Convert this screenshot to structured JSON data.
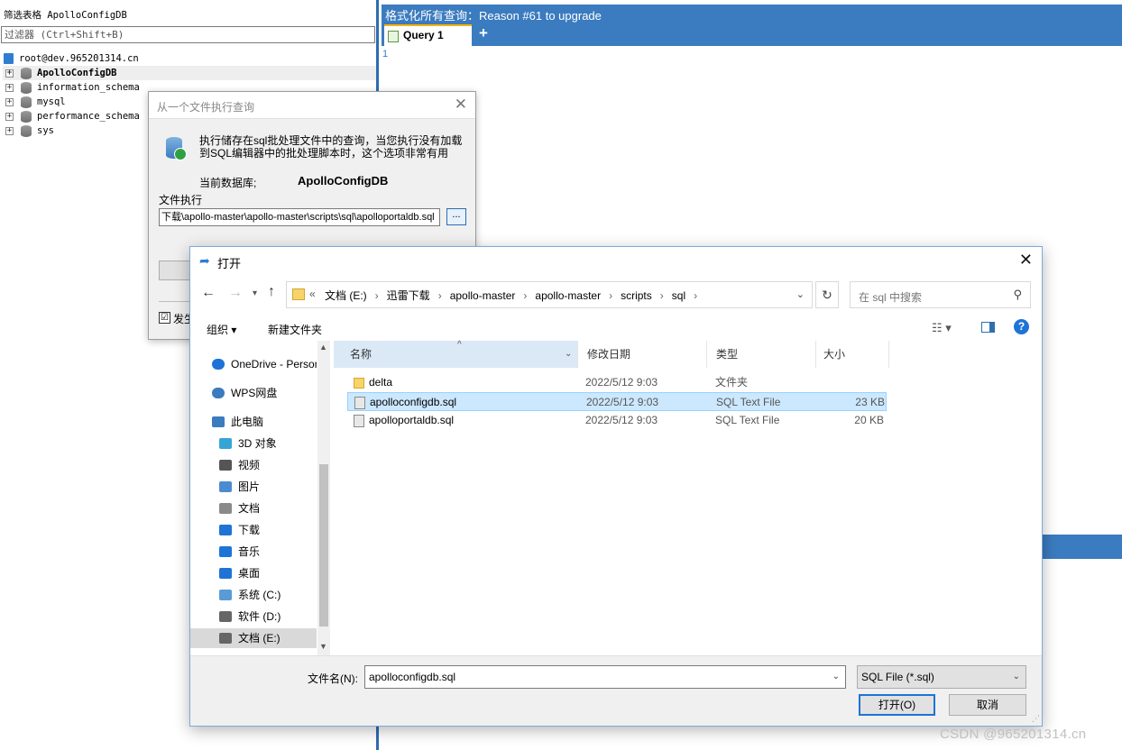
{
  "left_panel": {
    "filter_title": "筛选表格 ApolloConfigDB",
    "filter_placeholder": "过滤器 (Ctrl+Shift+B)",
    "connection": "root@dev.965201314.cn",
    "databases": [
      {
        "name": "ApolloConfigDB",
        "selected": true
      },
      {
        "name": "information_schema",
        "selected": false
      },
      {
        "name": "mysql",
        "selected": false
      },
      {
        "name": "performance_schema",
        "selected": false
      },
      {
        "name": "sys",
        "selected": false
      }
    ]
  },
  "editor": {
    "header_text": "格式化所有查询：Reason #61 to upgrade",
    "tab_label": "Query 1",
    "add_tab": "+",
    "line_number": "1"
  },
  "exec_dialog": {
    "title": "从一个文件执行查询",
    "close": "✕",
    "description": "执行储存在sql批处理文件中的查询，当您执行没有加载到SQL编辑器中的批处理脚本时，这个选项非常有用",
    "current_db_label": "当前数据库;",
    "current_db_value": "ApolloConfigDB",
    "file_exec_label": "文件执行",
    "file_path": "下载\\apollo-master\\apollo-master\\scripts\\sql\\apolloportaldb.sql",
    "browse_label": "...",
    "checkbox_label": "发生",
    "checkbox_checked": "☑"
  },
  "open_dialog": {
    "title": "打开",
    "close": "✕",
    "breadcrumbs": [
      "文档 (E:)",
      "迅雷下载",
      "apollo-master",
      "apollo-master",
      "scripts",
      "sql"
    ],
    "address_prefix": "«",
    "search_placeholder": "在 sql 中搜索",
    "toolbar": {
      "organize": "组织 ▾",
      "new_folder": "新建文件夹"
    },
    "nav_items": [
      {
        "label": "OneDrive - Personal",
        "icon": "cloud-icon",
        "color": "#1e73d6"
      },
      {
        "label": "WPS网盘",
        "icon": "cloud-icon",
        "color": "#3b7bbf"
      },
      {
        "label": "此电脑",
        "icon": "computer-icon",
        "color": "#3b7bbf"
      },
      {
        "label": "3D 对象",
        "icon": "cube-icon",
        "color": "#35a5d6"
      },
      {
        "label": "视频",
        "icon": "video-icon",
        "color": "#555555"
      },
      {
        "label": "图片",
        "icon": "picture-icon",
        "color": "#4b8bd0"
      },
      {
        "label": "文档",
        "icon": "document-icon",
        "color": "#8a8a8a"
      },
      {
        "label": "下载",
        "icon": "download-icon",
        "color": "#1e73d6"
      },
      {
        "label": "音乐",
        "icon": "music-icon",
        "color": "#1e73d6"
      },
      {
        "label": "桌面",
        "icon": "desktop-icon",
        "color": "#1e73d6"
      },
      {
        "label": "系统 (C:)",
        "icon": "drive-icon",
        "color": "#5a9bd5"
      },
      {
        "label": "软件 (D:)",
        "icon": "drive-icon",
        "color": "#666666"
      },
      {
        "label": "文档 (E:)",
        "icon": "drive-icon",
        "color": "#666666"
      }
    ],
    "columns": {
      "name": "名称",
      "date": "修改日期",
      "type": "类型",
      "size": "大小"
    },
    "files": [
      {
        "name": "delta",
        "date": "2022/5/12 9:03",
        "type": "文件夹",
        "size": "",
        "kind": "folder",
        "selected": false
      },
      {
        "name": "apolloconfigdb.sql",
        "date": "2022/5/12 9:03",
        "type": "SQL Text File",
        "size": "23 KB",
        "kind": "sql",
        "selected": true
      },
      {
        "name": "apolloportaldb.sql",
        "date": "2022/5/12 9:03",
        "type": "SQL Text File",
        "size": "20 KB",
        "kind": "sql",
        "selected": false
      }
    ],
    "filename_label": "文件名(N):",
    "filename_value": "apolloconfigdb.sql",
    "filetype_value": "SQL File (*.sql)",
    "open_button": "打开(O)",
    "cancel_button": "取消"
  },
  "watermark": "CSDN @965201314.cn",
  "colors": {
    "accent": "#3b7bbf",
    "selection": "#cce8ff",
    "primary_button_border": "#1e73d6"
  }
}
